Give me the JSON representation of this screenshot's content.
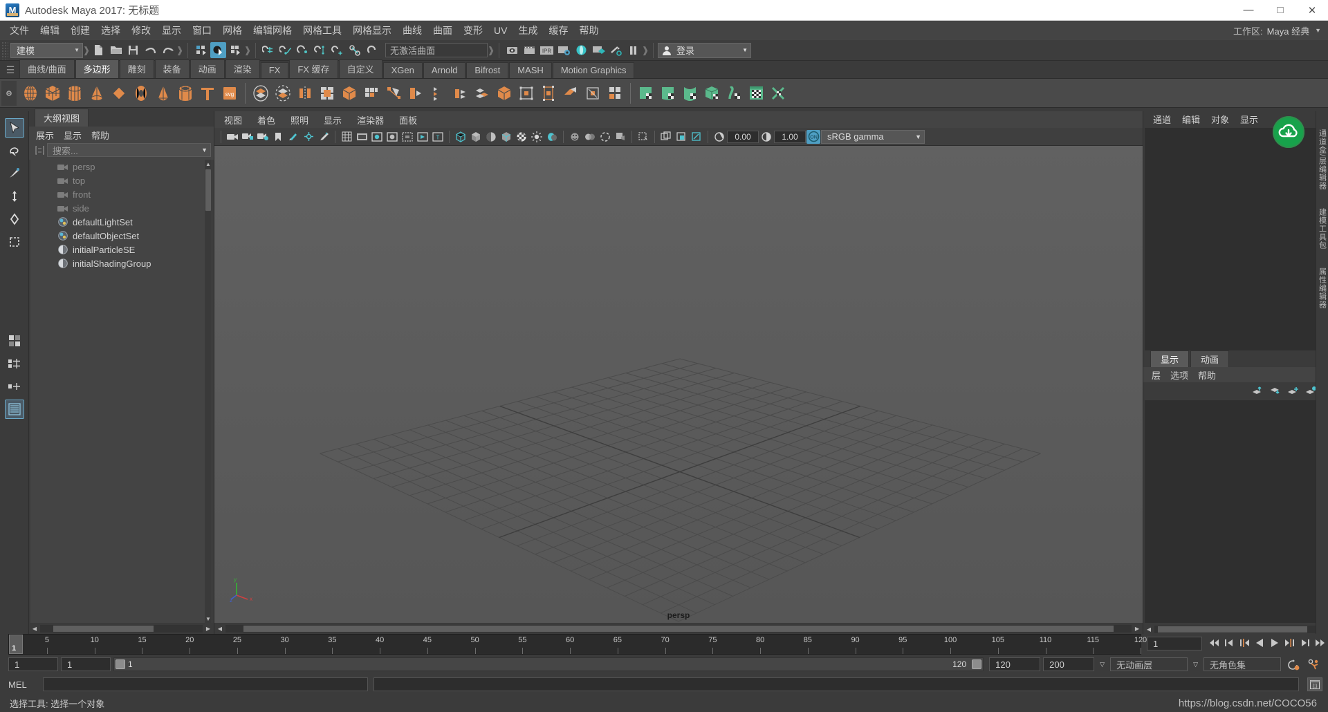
{
  "window": {
    "title": "Autodesk Maya 2017: 无标题",
    "logo_text": "M",
    "minimize": "—",
    "maximize": "□",
    "close": "✕"
  },
  "menubar": {
    "items": [
      "文件",
      "编辑",
      "创建",
      "选择",
      "修改",
      "显示",
      "窗口",
      "网格",
      "编辑网格",
      "网格工具",
      "网格显示",
      "曲线",
      "曲面",
      "变形",
      "UV",
      "生成",
      "缓存",
      "帮助"
    ],
    "workspace_label": "工作区:",
    "workspace_value": "Maya 经典",
    "workspace_arrow": "▼"
  },
  "statusbar": {
    "menuset": "建模",
    "menuset_arrow": "▼",
    "surface_field": "无激活曲面",
    "login_label": "登录",
    "login_arrow": "▼",
    "icons": [
      "new-scene-icon",
      "open-scene-icon",
      "save-scene-icon",
      "undo-icon",
      "redo-icon",
      "select-hierarchy-icon",
      "select-object-icon",
      "select-component-icon",
      "snap-grid-icon",
      "snap-curve-icon",
      "snap-point-icon",
      "snap-projected-icon",
      "snap-view-plane-icon",
      "make-live-icon",
      "construction-history-icon",
      "render-view-icon",
      "render-current-frame-icon",
      "ipr-render-icon",
      "render-settings-icon",
      "hypershade-icon",
      "render-sequence-icon",
      "light-fog-icon",
      "pause-icon"
    ]
  },
  "shelf": {
    "tabs": [
      "曲线/曲面",
      "多边形",
      "雕刻",
      "装备",
      "动画",
      "渲染",
      "FX",
      "FX 缓存",
      "自定义",
      "XGen",
      "Arnold",
      "Bifrost",
      "MASH",
      "Motion Graphics"
    ],
    "active_tab": "多边形",
    "icons": [
      "polysphere-icon",
      "polycube-icon",
      "polycylinder-icon",
      "polycone-icon",
      "polyplane-icon",
      "polytorus-icon",
      "polyprism-icon",
      "polypipe-icon",
      "polytype-icon",
      "polysvg-icon",
      "combine-icon",
      "separate-icon",
      "extract-icon",
      "booleans-icon",
      "mirror-icon",
      "smooth-icon",
      "retopologize-icon",
      "multicut-icon",
      "bevel-icon",
      "bridge-icon",
      "append-icon",
      "wedge-icon",
      "crease-icon",
      "target-weld-icon",
      "connect-icon",
      "quad-draw-icon",
      "sculpt-icon",
      "uv-planar-icon",
      "uv-cylindrical-icon",
      "uv-spherical-icon",
      "uv-automatic-icon",
      "uv-unfold-icon",
      "uv-editor-icon",
      "uv-cut-icon"
    ]
  },
  "tools": {
    "left_column": [
      "select-tool-icon",
      "lasso-select-icon",
      "paint-select-icon",
      "move-tool-icon",
      "rotate-tool-icon",
      "scale-tool-icon",
      "last-tool-icon",
      "show-manipulator-icon",
      "four-view-layout-icon",
      "persp-outliner-layout-icon",
      "persp-graph-layout-icon",
      "hypershade-layout-icon"
    ],
    "selected": "hypershade-layout-icon"
  },
  "outliner": {
    "tab": "大纲视图",
    "menus": [
      "展示",
      "显示",
      "帮助"
    ],
    "search_placeholder": "搜索...",
    "search_icon": "filter-icon",
    "search_arrow": "▼",
    "items": [
      {
        "label": "persp",
        "icon": "camera-icon",
        "dim": true
      },
      {
        "label": "top",
        "icon": "camera-icon",
        "dim": true
      },
      {
        "label": "front",
        "icon": "camera-icon",
        "dim": true
      },
      {
        "label": "side",
        "icon": "camera-icon",
        "dim": true
      },
      {
        "label": "defaultLightSet",
        "icon": "set-icon",
        "dim": false
      },
      {
        "label": "defaultObjectSet",
        "icon": "set-icon",
        "dim": false
      },
      {
        "label": "initialParticleSE",
        "icon": "shading-group-icon",
        "dim": false
      },
      {
        "label": "initialShadingGroup",
        "icon": "shading-group-icon",
        "dim": false
      }
    ]
  },
  "viewport": {
    "menus": [
      "视图",
      "着色",
      "照明",
      "显示",
      "渲染器",
      "面板"
    ],
    "exposure_value": "0.00",
    "gamma_value": "1.00",
    "colorspace": "sRGB gamma",
    "colorspace_arrow": "▼",
    "gamma_toggle": "ON",
    "camera_label": "persp",
    "axis": {
      "x": "x",
      "y": "y",
      "z": "z"
    },
    "toolbar_icons": [
      "select-camera-icon",
      "lock-camera-icon",
      "camera-attributes-icon",
      "bookmark-icon",
      "image-plane-icon",
      "two-d-pan-zoom-icon",
      "grease-pencil-icon",
      "grid-icon",
      "film-gate-icon",
      "resolution-gate-icon",
      "gate-mask-icon",
      "field-chart-icon",
      "safe-action-icon",
      "safe-title-icon",
      "wireframe-icon",
      "smooth-shade-icon",
      "shade-flat-icon",
      "wireframe-on-shaded-icon",
      "texture-icon",
      "lights-icon",
      "shadows-icon",
      "screen-space-ao-icon",
      "motion-blur-icon",
      "multisample-icon",
      "isolate-select-icon",
      "xray-icon",
      "xray-joints-icon",
      "xray-active-components-icon",
      "exposure-icon",
      "gamma-icon"
    ]
  },
  "channelbox": {
    "menus": [
      "通道",
      "编辑",
      "对象",
      "显示"
    ],
    "cloud_icon": "cloud-download-icon",
    "right_strip_labels": [
      "通道盒/层编辑器",
      "建模工具包",
      "属性编辑器"
    ]
  },
  "layers": {
    "tabs": [
      "显示",
      "动画"
    ],
    "active_tab": "显示",
    "menus": [
      "层",
      "选项",
      "帮助"
    ],
    "buttons": [
      "layer-move-up-icon",
      "layer-move-down-icon",
      "layer-new-icon",
      "layer-new-from-selected-icon"
    ]
  },
  "timeline": {
    "ticks": [
      5,
      10,
      15,
      20,
      25,
      30,
      35,
      40,
      45,
      50,
      55,
      60,
      65,
      70,
      75,
      80,
      85,
      90,
      95,
      100,
      105,
      110,
      115,
      120
    ],
    "playhead_frame": "1",
    "current_frame_field": "1",
    "playback_buttons": [
      "go-to-start-icon",
      "step-back-key-icon",
      "step-back-frame-icon",
      "play-backwards-icon",
      "play-forwards-icon",
      "step-forward-frame-icon",
      "step-forward-key-icon",
      "go-to-end-icon"
    ]
  },
  "range": {
    "start": "1",
    "end": "1",
    "bar_start_label": "1",
    "bar_end_label": "120",
    "anim_end": "120",
    "range_end": "200",
    "anim_layer": "无动画层",
    "anim_layer_arrow": "▽",
    "character_set": "无角色集",
    "character_set_arrow": "▽",
    "auto_key_icon": "auto-key-icon",
    "anim_prefs_icon": "animation-preferences-icon"
  },
  "command_line": {
    "label": "MEL",
    "input_value": "",
    "output_value": "",
    "script_editor_icon": "script-editor-icon"
  },
  "status": {
    "help_text": "选择工具: 选择一个对象",
    "watermark": "https://blog.csdn.net/COCO56"
  },
  "colors": {
    "accent_orange": "#e08a4a",
    "accent_teal": "#4f9fc4",
    "accent_green": "#5bb98c",
    "cloud_green": "#17a24b",
    "panel_bg": "#3b3b3b",
    "viewport_bg": "#5b5b5b"
  }
}
